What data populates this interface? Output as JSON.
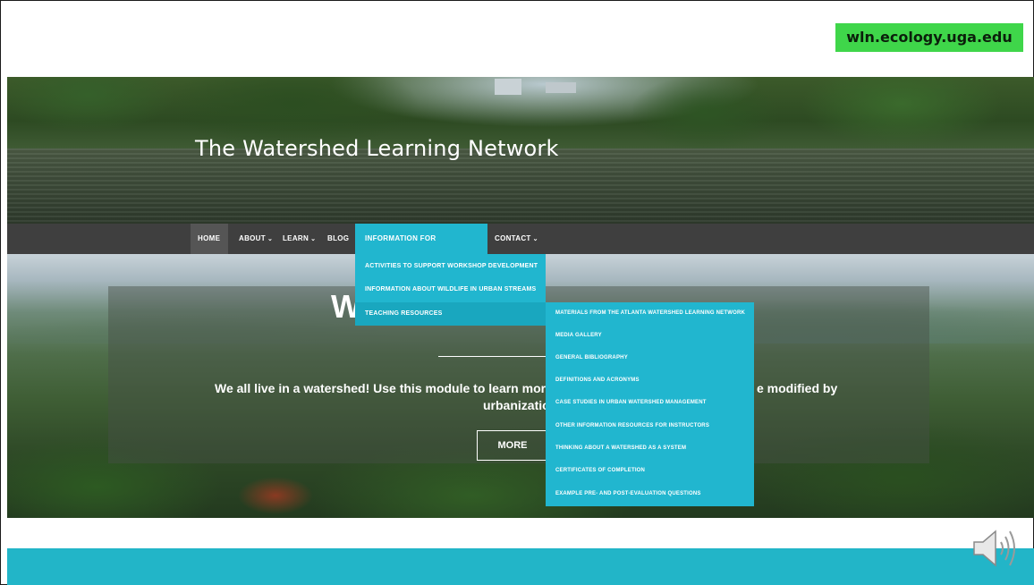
{
  "url_badge": "wln.ecology.uga.edu",
  "site_title": "The Watershed Learning Network",
  "nav": {
    "home": "HOME",
    "about": "ABOUT",
    "learn": "LEARN",
    "blog": "BLOG",
    "instructors": "INFORMATION FOR INSTRUCTORS",
    "contact": "CONTACT",
    "chevron": "⌄"
  },
  "instructors_menu": [
    "ACTIVITIES TO SUPPORT WORKSHOP DEVELOPMENT",
    "INFORMATION ABOUT WILDLIFE IN URBAN STREAMS",
    "TEACHING RESOURCES"
  ],
  "teaching_resources_menu": [
    "MATERIALS FROM THE ATLANTA WATERSHED LEARNING NETWORK",
    "MEDIA GALLERY",
    "GENERAL BIBLIOGRAPHY",
    "DEFINITIONS AND ACRONYMS",
    "CASE STUDIES IN URBAN WATERSHED MANAGEMENT",
    "OTHER INFORMATION RESOURCES FOR INSTRUCTORS",
    "THINKING ABOUT A WATERSHED AS A SYSTEM",
    "CERTIFICATES OF COMPLETION",
    "EXAMPLE PRE- AND POST-EVALUATION QUESTIONS"
  ],
  "hero_slide": {
    "heading_visible": "W",
    "description_left": "We all live in a watershed! Use this module to learn more what",
    "description_right": "e modified by",
    "description_line2": "urbanizatio",
    "more_button": "MORE"
  },
  "colors": {
    "accent": "#21b6cf",
    "badge": "#3fd64a",
    "navbar": "#3f3f3f"
  },
  "icons": {
    "speaker": "speaker-icon"
  }
}
